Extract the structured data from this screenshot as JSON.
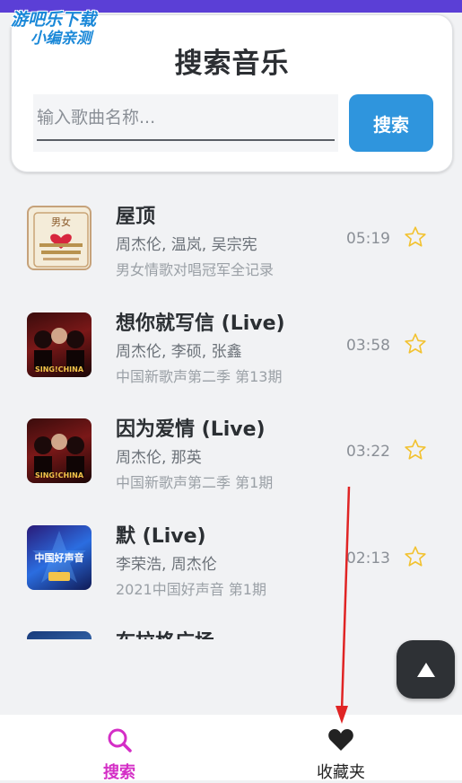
{
  "watermark": {
    "line1": "游吧乐下载",
    "line2": "小编亲测"
  },
  "search": {
    "title": "搜索音乐",
    "placeholder": "输入歌曲名称...",
    "value": "",
    "button_label": "搜索"
  },
  "songs": [
    {
      "title": "屋顶",
      "artists": "周杰伦, 温岚, 吴宗宪",
      "album": "男女情歌对唱冠军全记录",
      "duration": "05:19",
      "favorited": false,
      "cover_text": "男女"
    },
    {
      "title": "想你就写信 (Live)",
      "artists": "周杰伦, 李硕, 张鑫",
      "album": "中国新歌声第二季 第13期",
      "duration": "03:58",
      "favorited": false,
      "cover_text": "SING!CHINA"
    },
    {
      "title": "因为爱情 (Live)",
      "artists": "周杰伦, 那英",
      "album": "中国新歌声第二季 第1期",
      "duration": "03:22",
      "favorited": false,
      "cover_text": "SING!CHINA"
    },
    {
      "title": "默 (Live)",
      "artists": "李荣浩, 周杰伦",
      "album": "2021中国好声音 第1期",
      "duration": "02:13",
      "favorited": false,
      "cover_text": "中国好声音"
    },
    {
      "title": "布拉格广场",
      "artists": "",
      "album": "",
      "duration": "",
      "favorited": false,
      "cover_text": ""
    }
  ],
  "bottom_nav": [
    {
      "label": "搜索",
      "icon": "search-icon",
      "active": true
    },
    {
      "label": "收藏夹",
      "icon": "heart-icon",
      "active": false
    }
  ],
  "colors": {
    "accent": "#2f95dd",
    "active_nav": "#d42ec6",
    "star": "#f2c230",
    "top_bar": "#5b3fd6",
    "annotation_arrow": "#e02424"
  }
}
